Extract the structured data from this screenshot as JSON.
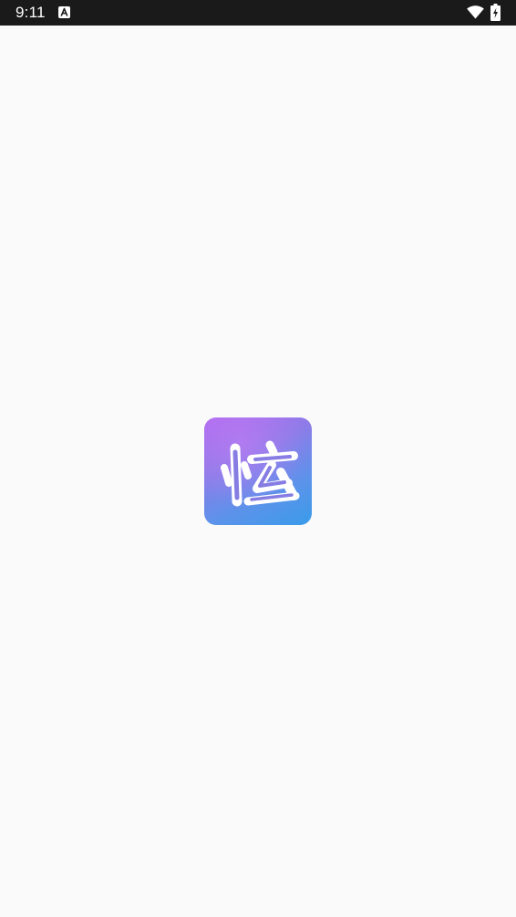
{
  "status_bar": {
    "time": "9:11",
    "notification_icon": "font-a-icon",
    "wifi_icon": "wifi-icon",
    "battery_icon": "battery-charging-icon"
  },
  "splash": {
    "logo_icon": "app-logo-icon",
    "logo_glyph": "炫"
  },
  "colors": {
    "status_bar_bg": "#1a1a1a",
    "page_bg": "#fafafa",
    "logo_gradient_start": "#b06cf0",
    "logo_gradient_end": "#3a9bea"
  }
}
